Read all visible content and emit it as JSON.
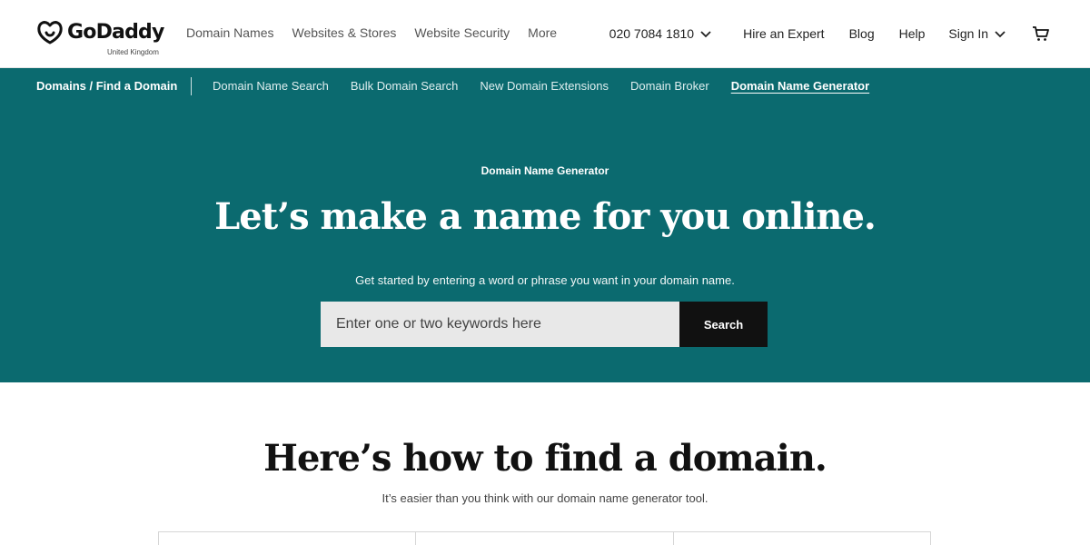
{
  "header": {
    "brand": "GoDaddy",
    "region": "United Kingdom",
    "nav": [
      "Domain Names",
      "Websites & Stores",
      "Website Security",
      "More"
    ],
    "phone": "020 7084 1810",
    "hire": "Hire an Expert",
    "blog": "Blog",
    "help": "Help",
    "sign_in": "Sign In"
  },
  "subnav": {
    "crumb": "Domains / Find a Domain",
    "links": [
      "Domain Name Search",
      "Bulk Domain Search",
      "New Domain Extensions",
      "Domain Broker",
      "Domain Name Generator"
    ],
    "active": "Domain Name Generator"
  },
  "hero": {
    "eyebrow": "Domain Name Generator",
    "title": "Let’s make a name for you online.",
    "lede": "Get started by entering a word or phrase you want in your domain name.",
    "search_placeholder": "Enter one or two keywords here",
    "search_button": "Search"
  },
  "howto": {
    "title": "Here’s how to find a domain.",
    "subtitle": "It’s easier than you think with our domain name generator tool."
  },
  "colors": {
    "teal": "#0b6a6f",
    "button": "#111111"
  }
}
